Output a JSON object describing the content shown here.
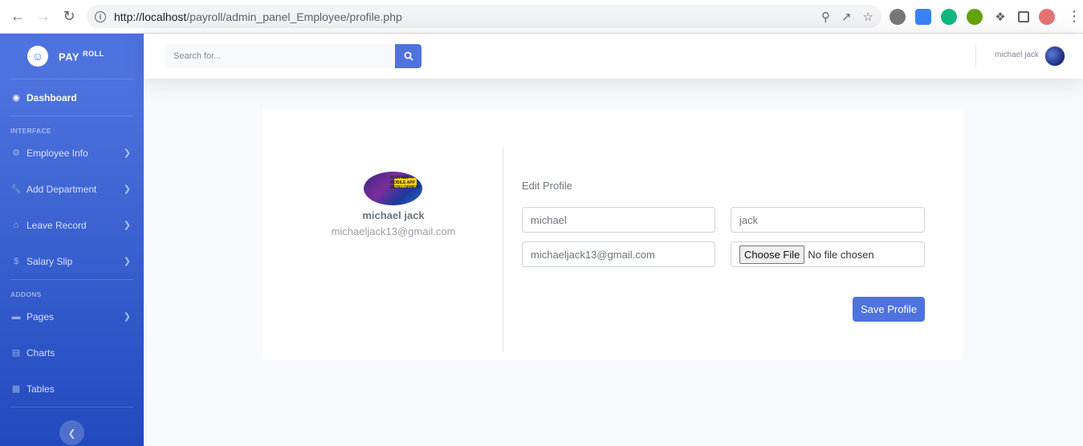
{
  "browser": {
    "url_host": "http://localhost",
    "url_path": "/payroll/admin_panel_Employee/profile.php"
  },
  "brand": {
    "name": "PAY",
    "sup": "ROLL"
  },
  "sidebar": {
    "dashboard": "Dashboard",
    "heading_interface": "INTERFACE",
    "items_interface": [
      {
        "label": "Employee Info",
        "icon": "gear-icon"
      },
      {
        "label": "Add Department",
        "icon": "wrench-icon"
      },
      {
        "label": "Leave Record",
        "icon": "home-icon"
      },
      {
        "label": "Salary Slip",
        "icon": "dollar-icon"
      }
    ],
    "heading_addons": "ADDONS",
    "items_addons": [
      {
        "label": "Pages",
        "icon": "folder-icon"
      },
      {
        "label": "Charts",
        "icon": "chart-area-icon"
      },
      {
        "label": "Tables",
        "icon": "table-icon"
      }
    ]
  },
  "topbar": {
    "search_placeholder": "Search for...",
    "user_name": "michael jack"
  },
  "profile": {
    "name": "michael jack",
    "email": "michaeljack13@gmail.com",
    "image_text": "FLUTTER MOBILE APP DEVELOPMENT"
  },
  "form": {
    "title": "Edit Profile",
    "first_name": "michael",
    "last_name": "jack",
    "email": "michaeljack13@gmail.com",
    "file_button": "Choose File",
    "file_status": "No file chosen",
    "save_label": "Save Profile"
  },
  "colors": {
    "primary": "#4e73df",
    "sidebar_end": "#224abe"
  }
}
